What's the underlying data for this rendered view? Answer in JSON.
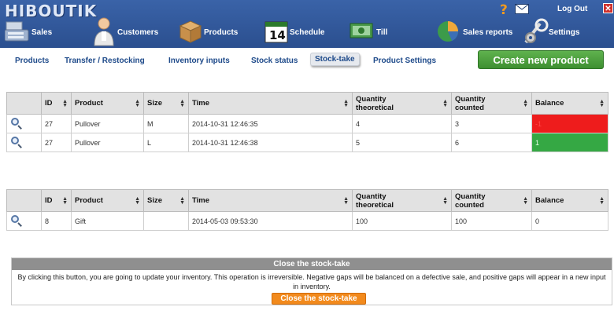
{
  "app": {
    "logo": "HIBOUTIK",
    "logout": "Log Out",
    "close_symbol": "✕"
  },
  "nav": [
    {
      "label": "Sales",
      "icon": "register-icon"
    },
    {
      "label": "Customers",
      "icon": "customer-icon"
    },
    {
      "label": "Products",
      "icon": "box-icon"
    },
    {
      "label": "Schedule",
      "icon": "calendar-icon",
      "icon_text": "14"
    },
    {
      "label": "Till",
      "icon": "cash-icon"
    },
    {
      "label": "Sales reports",
      "icon": "piechart-icon"
    },
    {
      "label": "Settings",
      "icon": "gears-icon"
    }
  ],
  "subnav": [
    {
      "label": "Products"
    },
    {
      "label": "Transfer / Restocking"
    },
    {
      "label": "Inventory inputs"
    },
    {
      "label": "Stock status"
    },
    {
      "label": "Stock-take",
      "active": true
    },
    {
      "label": "Product Settings"
    }
  ],
  "create_button": "Create new product",
  "table_headers": [
    "ID",
    "Product",
    "Size",
    "Time",
    "Quantity theoretical",
    "Quantity counted",
    "Balance"
  ],
  "table1": [
    {
      "id": "27",
      "product": "Pullover",
      "size": "M",
      "time": "2014-10-31 12:46:35",
      "theoretical": "4",
      "counted": "3",
      "balance": "-1",
      "status": "negative"
    },
    {
      "id": "27",
      "product": "Pullover",
      "size": "L",
      "time": "2014-10-31 12:46:38",
      "theoretical": "5",
      "counted": "6",
      "balance": "1",
      "status": "positive"
    }
  ],
  "table2": [
    {
      "id": "8",
      "product": "Gift",
      "size": "",
      "time": "2014-05-03 09:53:30",
      "theoretical": "100",
      "counted": "100",
      "balance": "0",
      "status": "neutral"
    }
  ],
  "close_section": {
    "title": "Close the stock-take",
    "description": "By clicking this button, you are going to update your inventory. This operation is irreversible. Negative gaps will be balanced on a defective sale, and positive gaps will appear in a new input in inventory.",
    "button": "Close the stock-take"
  },
  "colors": {
    "header": "#2f5597",
    "negative": "#ee1c1c",
    "positive": "#35a844",
    "create": "#4fa33f",
    "close_btn": "#f28a1d"
  }
}
